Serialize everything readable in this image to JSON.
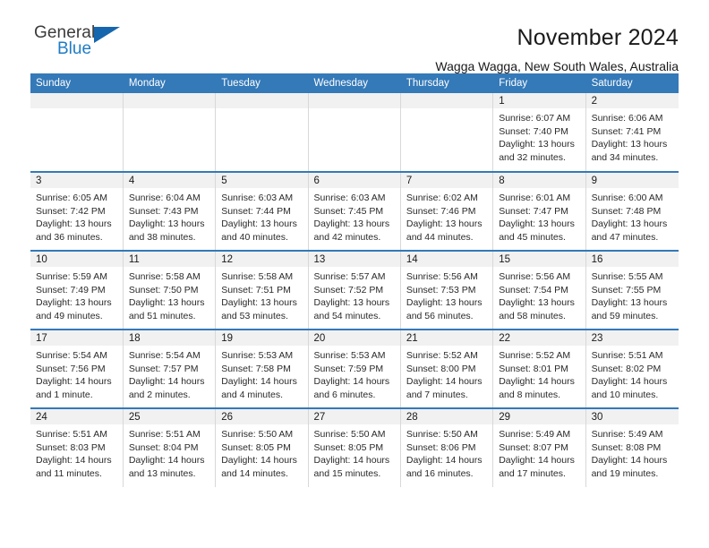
{
  "brand": {
    "name_part1": "General",
    "name_part2": "Blue",
    "accent_color": "#1f7cc4",
    "triangle_color": "#1666ad"
  },
  "header": {
    "title": "November 2024",
    "subtitle": "Wagga Wagga, New South Wales, Australia",
    "header_bg": "#3479b8",
    "daynum_bg": "#f1f1f1"
  },
  "weekday_headers": [
    "Sunday",
    "Monday",
    "Tuesday",
    "Wednesday",
    "Thursday",
    "Friday",
    "Saturday"
  ],
  "weeks": [
    [
      {
        "day": "",
        "empty": true
      },
      {
        "day": "",
        "empty": true
      },
      {
        "day": "",
        "empty": true
      },
      {
        "day": "",
        "empty": true
      },
      {
        "day": "",
        "empty": true
      },
      {
        "day": "1",
        "sunrise": "Sunrise: 6:07 AM",
        "sunset": "Sunset: 7:40 PM",
        "daylight_line1": "Daylight: 13 hours",
        "daylight_line2": "and 32 minutes."
      },
      {
        "day": "2",
        "sunrise": "Sunrise: 6:06 AM",
        "sunset": "Sunset: 7:41 PM",
        "daylight_line1": "Daylight: 13 hours",
        "daylight_line2": "and 34 minutes."
      }
    ],
    [
      {
        "day": "3",
        "sunrise": "Sunrise: 6:05 AM",
        "sunset": "Sunset: 7:42 PM",
        "daylight_line1": "Daylight: 13 hours",
        "daylight_line2": "and 36 minutes."
      },
      {
        "day": "4",
        "sunrise": "Sunrise: 6:04 AM",
        "sunset": "Sunset: 7:43 PM",
        "daylight_line1": "Daylight: 13 hours",
        "daylight_line2": "and 38 minutes."
      },
      {
        "day": "5",
        "sunrise": "Sunrise: 6:03 AM",
        "sunset": "Sunset: 7:44 PM",
        "daylight_line1": "Daylight: 13 hours",
        "daylight_line2": "and 40 minutes."
      },
      {
        "day": "6",
        "sunrise": "Sunrise: 6:03 AM",
        "sunset": "Sunset: 7:45 PM",
        "daylight_line1": "Daylight: 13 hours",
        "daylight_line2": "and 42 minutes."
      },
      {
        "day": "7",
        "sunrise": "Sunrise: 6:02 AM",
        "sunset": "Sunset: 7:46 PM",
        "daylight_line1": "Daylight: 13 hours",
        "daylight_line2": "and 44 minutes."
      },
      {
        "day": "8",
        "sunrise": "Sunrise: 6:01 AM",
        "sunset": "Sunset: 7:47 PM",
        "daylight_line1": "Daylight: 13 hours",
        "daylight_line2": "and 45 minutes."
      },
      {
        "day": "9",
        "sunrise": "Sunrise: 6:00 AM",
        "sunset": "Sunset: 7:48 PM",
        "daylight_line1": "Daylight: 13 hours",
        "daylight_line2": "and 47 minutes."
      }
    ],
    [
      {
        "day": "10",
        "sunrise": "Sunrise: 5:59 AM",
        "sunset": "Sunset: 7:49 PM",
        "daylight_line1": "Daylight: 13 hours",
        "daylight_line2": "and 49 minutes."
      },
      {
        "day": "11",
        "sunrise": "Sunrise: 5:58 AM",
        "sunset": "Sunset: 7:50 PM",
        "daylight_line1": "Daylight: 13 hours",
        "daylight_line2": "and 51 minutes."
      },
      {
        "day": "12",
        "sunrise": "Sunrise: 5:58 AM",
        "sunset": "Sunset: 7:51 PM",
        "daylight_line1": "Daylight: 13 hours",
        "daylight_line2": "and 53 minutes."
      },
      {
        "day": "13",
        "sunrise": "Sunrise: 5:57 AM",
        "sunset": "Sunset: 7:52 PM",
        "daylight_line1": "Daylight: 13 hours",
        "daylight_line2": "and 54 minutes."
      },
      {
        "day": "14",
        "sunrise": "Sunrise: 5:56 AM",
        "sunset": "Sunset: 7:53 PM",
        "daylight_line1": "Daylight: 13 hours",
        "daylight_line2": "and 56 minutes."
      },
      {
        "day": "15",
        "sunrise": "Sunrise: 5:56 AM",
        "sunset": "Sunset: 7:54 PM",
        "daylight_line1": "Daylight: 13 hours",
        "daylight_line2": "and 58 minutes."
      },
      {
        "day": "16",
        "sunrise": "Sunrise: 5:55 AM",
        "sunset": "Sunset: 7:55 PM",
        "daylight_line1": "Daylight: 13 hours",
        "daylight_line2": "and 59 minutes."
      }
    ],
    [
      {
        "day": "17",
        "sunrise": "Sunrise: 5:54 AM",
        "sunset": "Sunset: 7:56 PM",
        "daylight_line1": "Daylight: 14 hours",
        "daylight_line2": "and 1 minute."
      },
      {
        "day": "18",
        "sunrise": "Sunrise: 5:54 AM",
        "sunset": "Sunset: 7:57 PM",
        "daylight_line1": "Daylight: 14 hours",
        "daylight_line2": "and 2 minutes."
      },
      {
        "day": "19",
        "sunrise": "Sunrise: 5:53 AM",
        "sunset": "Sunset: 7:58 PM",
        "daylight_line1": "Daylight: 14 hours",
        "daylight_line2": "and 4 minutes."
      },
      {
        "day": "20",
        "sunrise": "Sunrise: 5:53 AM",
        "sunset": "Sunset: 7:59 PM",
        "daylight_line1": "Daylight: 14 hours",
        "daylight_line2": "and 6 minutes."
      },
      {
        "day": "21",
        "sunrise": "Sunrise: 5:52 AM",
        "sunset": "Sunset: 8:00 PM",
        "daylight_line1": "Daylight: 14 hours",
        "daylight_line2": "and 7 minutes."
      },
      {
        "day": "22",
        "sunrise": "Sunrise: 5:52 AM",
        "sunset": "Sunset: 8:01 PM",
        "daylight_line1": "Daylight: 14 hours",
        "daylight_line2": "and 8 minutes."
      },
      {
        "day": "23",
        "sunrise": "Sunrise: 5:51 AM",
        "sunset": "Sunset: 8:02 PM",
        "daylight_line1": "Daylight: 14 hours",
        "daylight_line2": "and 10 minutes."
      }
    ],
    [
      {
        "day": "24",
        "sunrise": "Sunrise: 5:51 AM",
        "sunset": "Sunset: 8:03 PM",
        "daylight_line1": "Daylight: 14 hours",
        "daylight_line2": "and 11 minutes."
      },
      {
        "day": "25",
        "sunrise": "Sunrise: 5:51 AM",
        "sunset": "Sunset: 8:04 PM",
        "daylight_line1": "Daylight: 14 hours",
        "daylight_line2": "and 13 minutes."
      },
      {
        "day": "26",
        "sunrise": "Sunrise: 5:50 AM",
        "sunset": "Sunset: 8:05 PM",
        "daylight_line1": "Daylight: 14 hours",
        "daylight_line2": "and 14 minutes."
      },
      {
        "day": "27",
        "sunrise": "Sunrise: 5:50 AM",
        "sunset": "Sunset: 8:05 PM",
        "daylight_line1": "Daylight: 14 hours",
        "daylight_line2": "and 15 minutes."
      },
      {
        "day": "28",
        "sunrise": "Sunrise: 5:50 AM",
        "sunset": "Sunset: 8:06 PM",
        "daylight_line1": "Daylight: 14 hours",
        "daylight_line2": "and 16 minutes."
      },
      {
        "day": "29",
        "sunrise": "Sunrise: 5:49 AM",
        "sunset": "Sunset: 8:07 PM",
        "daylight_line1": "Daylight: 14 hours",
        "daylight_line2": "and 17 minutes."
      },
      {
        "day": "30",
        "sunrise": "Sunrise: 5:49 AM",
        "sunset": "Sunset: 8:08 PM",
        "daylight_line1": "Daylight: 14 hours",
        "daylight_line2": "and 19 minutes."
      }
    ]
  ]
}
